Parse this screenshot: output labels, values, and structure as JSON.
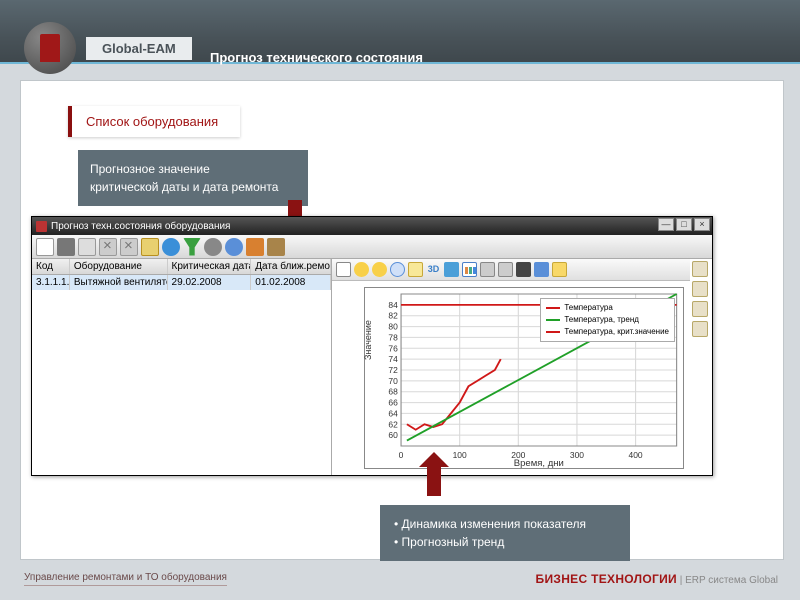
{
  "header": {
    "brand": "Global-EAM",
    "page_title": "Прогноз технического состояния"
  },
  "callouts": {
    "c1": "Список оборудования",
    "c2_line1": "Прогнозное значение",
    "c2_line2": "критической даты и дата ремонта",
    "c3_line1": "• Динамика изменения показателя",
    "c3_line2": "• Прогнозный тренд"
  },
  "app": {
    "title": "Прогноз техн.состояния оборудования",
    "win_min": "—",
    "win_max": "□",
    "win_close": "×",
    "table": {
      "headers": [
        "Код",
        "Оборудование",
        "Критическая дата",
        "Дата ближ.ремонта"
      ],
      "row": [
        "3.1.1.1.",
        "Вытяжной вентилятор ВКР-S",
        "29.02.2008",
        "01.02.2008"
      ]
    }
  },
  "chart_data": {
    "type": "line",
    "title": "",
    "xlabel": "Время, дни",
    "ylabel": "Значение",
    "xlim": [
      0,
      470
    ],
    "ylim": [
      58,
      86
    ],
    "x_ticks": [
      0,
      100,
      200,
      300,
      400
    ],
    "y_ticks": [
      60,
      62,
      64,
      66,
      68,
      70,
      72,
      74,
      76,
      78,
      80,
      82,
      84
    ],
    "series": [
      {
        "name": "Температура",
        "color": "#d01818",
        "x": [
          10,
          25,
          40,
          55,
          70,
          85,
          100,
          115,
          130,
          145,
          160,
          170
        ],
        "y": [
          62,
          61,
          62,
          61.5,
          62,
          64,
          66,
          69,
          70,
          71,
          72,
          74
        ]
      },
      {
        "name": "Температура, тренд",
        "color": "#20a028",
        "x": [
          10,
          470
        ],
        "y": [
          59,
          86
        ]
      },
      {
        "name": "Температура, крит.значение",
        "color": "#d01818",
        "x": [
          0,
          470
        ],
        "y": [
          84,
          84
        ]
      }
    ]
  },
  "chart": {
    "i3d": "3D",
    "legend": {
      "s1": "Температура",
      "s2": "Температура, тренд",
      "s3": "Температура, крит.значение"
    }
  },
  "footer": {
    "left": "Управление ремонтами и ТО оборудования",
    "right_brand": "БИЗНЕС ТЕХНОЛОГИИ",
    "right_sep": " | ",
    "right_product": "ERP система Global"
  }
}
